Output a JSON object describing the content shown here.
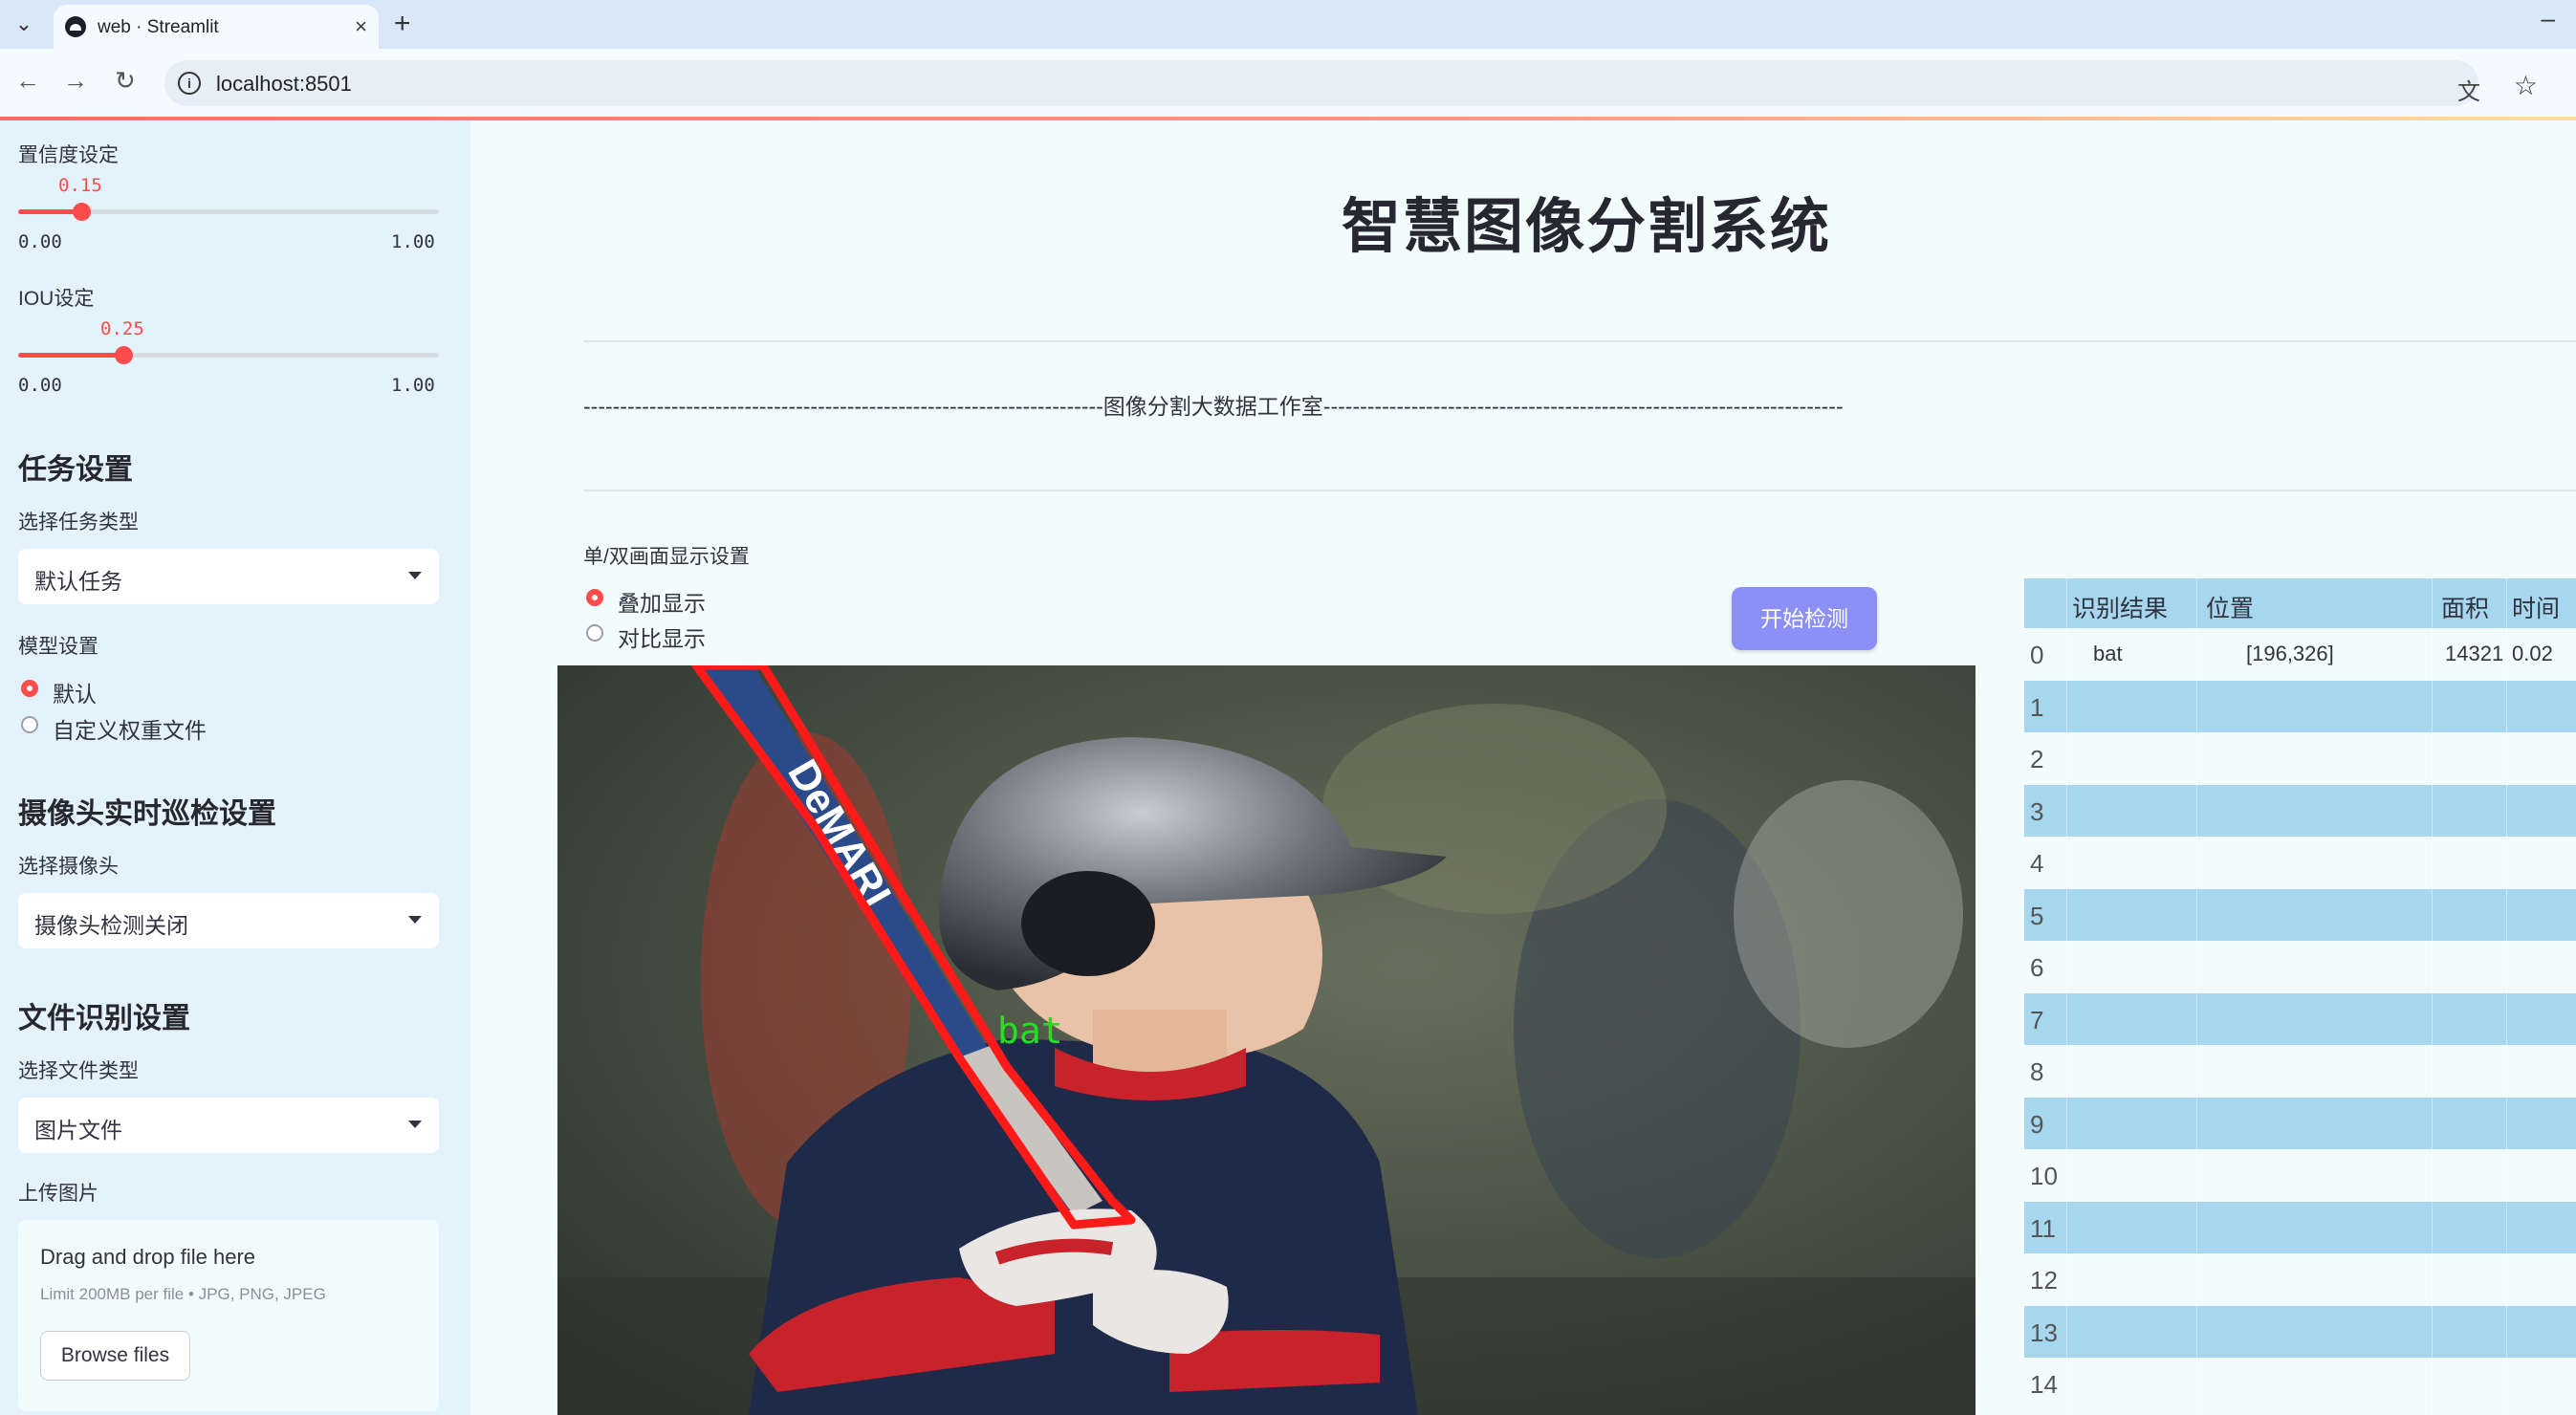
{
  "browser": {
    "tab_title": "web · Streamlit",
    "url": "localhost:8501"
  },
  "sidebar": {
    "confidence": {
      "label": "置信度设定",
      "value": "0.15",
      "value_fraction": 0.15,
      "min": "0.00",
      "max": "1.00"
    },
    "iou": {
      "label": "IOU设定",
      "value": "0.25",
      "value_fraction": 0.25,
      "min": "0.00",
      "max": "1.00"
    },
    "task": {
      "heading": "任务设置",
      "label": "选择任务类型",
      "selected": "默认任务"
    },
    "model": {
      "label": "模型设置",
      "options": [
        "默认",
        "自定义权重文件"
      ],
      "selected_index": 0
    },
    "camera": {
      "heading": "摄像头实时巡检设置",
      "label": "选择摄像头",
      "selected": "摄像头检测关闭"
    },
    "file": {
      "heading": "文件识别设置",
      "label": "选择文件类型",
      "selected": "图片文件"
    },
    "upload": {
      "label": "上传图片",
      "title": "Drag and drop file here",
      "hint": "Limit 200MB per file • JPG, PNG, JPEG",
      "button": "Browse files"
    }
  },
  "main": {
    "title": "智慧图像分割系统",
    "subtitle": "-----------------------------------------------------------------------图像分割大数据工作室-----------------------------------------------------------------------",
    "display": {
      "label": "单/双画面显示设置",
      "options": [
        "叠加显示",
        "对比显示"
      ],
      "selected_index": 0
    },
    "start_button": "开始检测",
    "image_label": "bat"
  },
  "table": {
    "headers": [
      "识别结果",
      "位置",
      "面积",
      "时间"
    ],
    "rows": [
      {
        "index": "0",
        "result": "bat",
        "position": "[196,326]",
        "area": "14321",
        "time": "0.02"
      },
      {
        "index": "1"
      },
      {
        "index": "2"
      },
      {
        "index": "3"
      },
      {
        "index": "4"
      },
      {
        "index": "5"
      },
      {
        "index": "6"
      },
      {
        "index": "7"
      },
      {
        "index": "8"
      },
      {
        "index": "9"
      },
      {
        "index": "10"
      },
      {
        "index": "11"
      },
      {
        "index": "12"
      },
      {
        "index": "13"
      },
      {
        "index": "14"
      }
    ]
  },
  "colors": {
    "accent": "#ff4b4b",
    "button": "#8c8ff6",
    "table_stripe": "#a7d6ef",
    "sidebar_bg": "#e3f2fb"
  }
}
